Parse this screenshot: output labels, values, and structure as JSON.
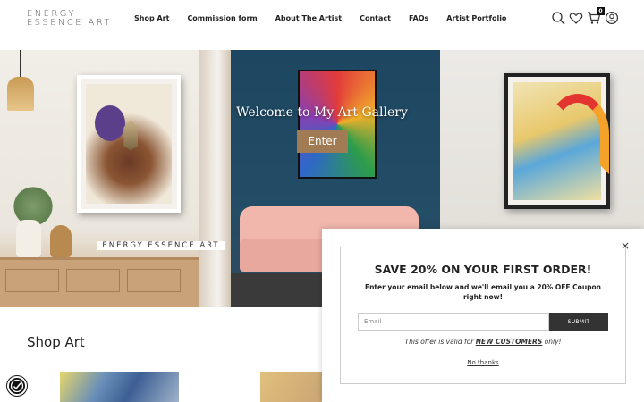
{
  "header": {
    "logo_line1": "ENERGY",
    "logo_line2": "ESSENCE ART",
    "nav": [
      "Shop Art",
      "Commission form",
      "About The Artist",
      "Contact",
      "FAQs",
      "Artist Portfolio"
    ],
    "cart_count": "0",
    "icons": [
      "search-icon",
      "heart-icon",
      "cart-icon",
      "account-icon"
    ]
  },
  "hero": {
    "title": "Welcome to My Art Gallery",
    "button_label": "Enter",
    "button_color": "#a07b54"
  },
  "shop": {
    "title": "Shop Art"
  },
  "popup": {
    "brand": "ENERGY ESSENCE ART",
    "close_label": "×",
    "headline": "SAVE 20% ON YOUR FIRST ORDER!",
    "description": "Enter your email below and we'll email you a 20% OFF Coupon right now!",
    "email_placeholder": "Email",
    "submit_label": "SUBMIT",
    "offer_prefix": "This offer is valid for",
    "offer_highlight": "NEW CUSTOMERS",
    "offer_suffix": "only!",
    "dismiss_label": "No thanks"
  },
  "accessibility": {
    "icon": "accessibility-icon"
  }
}
